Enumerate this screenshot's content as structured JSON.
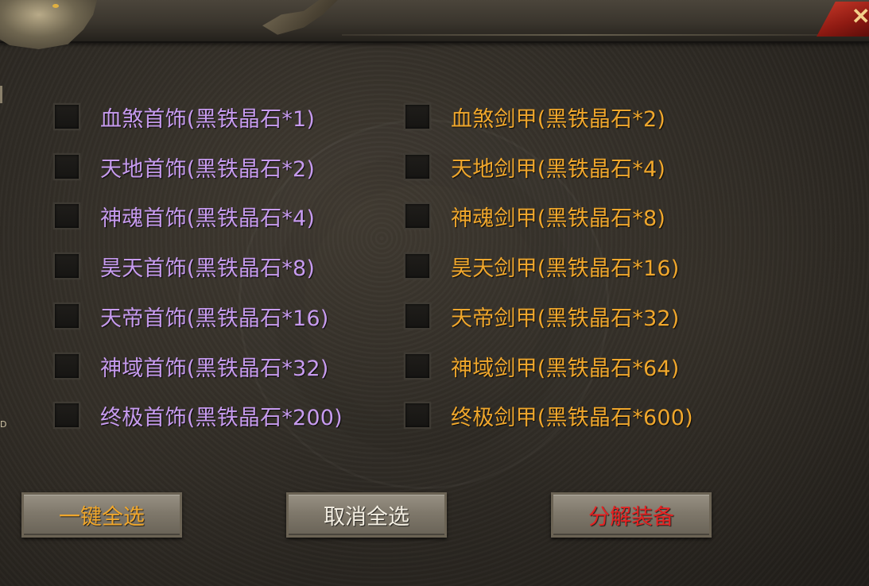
{
  "header": {
    "close_icon": "close-icon"
  },
  "side_mark": "D",
  "accessories": [
    {
      "label": "血煞首饰(黑铁晶石*1)",
      "checked": false
    },
    {
      "label": "天地首饰(黑铁晶石*2)",
      "checked": false
    },
    {
      "label": "神魂首饰(黑铁晶石*4)",
      "checked": false
    },
    {
      "label": "昊天首饰(黑铁晶石*8)",
      "checked": false
    },
    {
      "label": "天帝首饰(黑铁晶石*16)",
      "checked": false
    },
    {
      "label": "神域首饰(黑铁晶石*32)",
      "checked": false
    },
    {
      "label": "终极首饰(黑铁晶石*200)",
      "checked": false
    }
  ],
  "armors": [
    {
      "label": "血煞剑甲(黑铁晶石*2)",
      "checked": false
    },
    {
      "label": "天地剑甲(黑铁晶石*4)",
      "checked": false
    },
    {
      "label": "神魂剑甲(黑铁晶石*8)",
      "checked": false
    },
    {
      "label": "昊天剑甲(黑铁晶石*16)",
      "checked": false
    },
    {
      "label": "天帝剑甲(黑铁晶石*32)",
      "checked": false
    },
    {
      "label": "神域剑甲(黑铁晶石*64)",
      "checked": false
    },
    {
      "label": "终极剑甲(黑铁晶石*600)",
      "checked": false
    }
  ],
  "buttons": {
    "select_all": "一键全选",
    "deselect_all": "取消全选",
    "decompose": "分解装备"
  },
  "colors": {
    "accessory_text": "#c79bef",
    "armor_text": "#f0a72c",
    "decompose_text": "#e42222",
    "close_button": "#c93a2a"
  }
}
